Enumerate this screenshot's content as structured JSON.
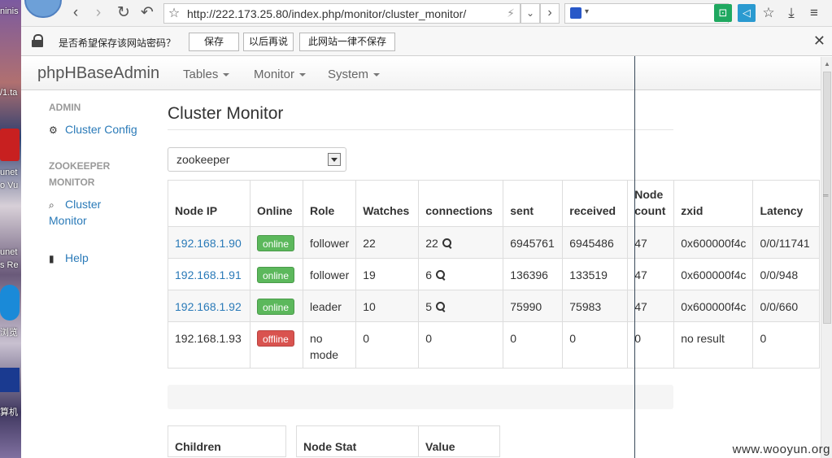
{
  "desktop": {
    "texts": [
      "ninis",
      "/1.ta",
      "unet",
      "o Vu",
      "unet",
      "s Re",
      "浏览",
      "算机"
    ]
  },
  "browser": {
    "url": "http://222.173.25.80/index.php/monitor/cluster_monitor/",
    "password_prompt": {
      "message": "是否希望保存该网站密码？",
      "save_label": "保存",
      "later_label": "以后再说",
      "never_label": "此网站一律不保存"
    }
  },
  "navbar": {
    "brand": "phpHBaseAdmin",
    "items": [
      "Tables",
      "Monitor",
      "System"
    ]
  },
  "sidebar": {
    "admin_header": "ADMIN",
    "cluster_config": "Cluster Config",
    "zk_header_line1": "ZOOKEEPER",
    "zk_header_line2": "MONITOR",
    "cluster_monitor_line1": "Cluster",
    "cluster_monitor_line2": "Monitor",
    "help": "Help"
  },
  "main": {
    "title": "Cluster Monitor",
    "select_value": "zookeeper",
    "table": {
      "headers": [
        "Node IP",
        "Online",
        "Role",
        "Watches",
        "connections",
        "sent",
        "received",
        "Node count",
        "zxid",
        "Latency"
      ],
      "rows": [
        {
          "ip": "192.168.1.90",
          "online": "online",
          "role": "follower",
          "watches": "22",
          "connections": "22",
          "sent": "6945761",
          "received": "6945486",
          "node_count": "47",
          "zxid": "0x600000f4c",
          "latency": "0/0/11741"
        },
        {
          "ip": "192.168.1.91",
          "online": "online",
          "role": "follower",
          "watches": "19",
          "connections": "6",
          "sent": "136396",
          "received": "133519",
          "node_count": "47",
          "zxid": "0x600000f4c",
          "latency": "0/0/948"
        },
        {
          "ip": "192.168.1.92",
          "online": "online",
          "role": "leader",
          "watches": "10",
          "connections": "5",
          "sent": "75990",
          "received": "75983",
          "node_count": "47",
          "zxid": "0x600000f4c",
          "latency": "0/0/660"
        },
        {
          "ip": "192.168.1.93",
          "online": "offline",
          "role": "no mode",
          "watches": "0",
          "connections": "0",
          "sent": "0",
          "received": "0",
          "node_count": "0",
          "zxid": "no result",
          "latency": "0"
        }
      ]
    },
    "children_header": "Children",
    "node_stat_header": "Node Stat",
    "value_header": "Value"
  },
  "watermark": "www.wooyun.org",
  "colors": {
    "link": "#2a7ab8",
    "online": "#5cb85c",
    "offline": "#d9534f"
  }
}
